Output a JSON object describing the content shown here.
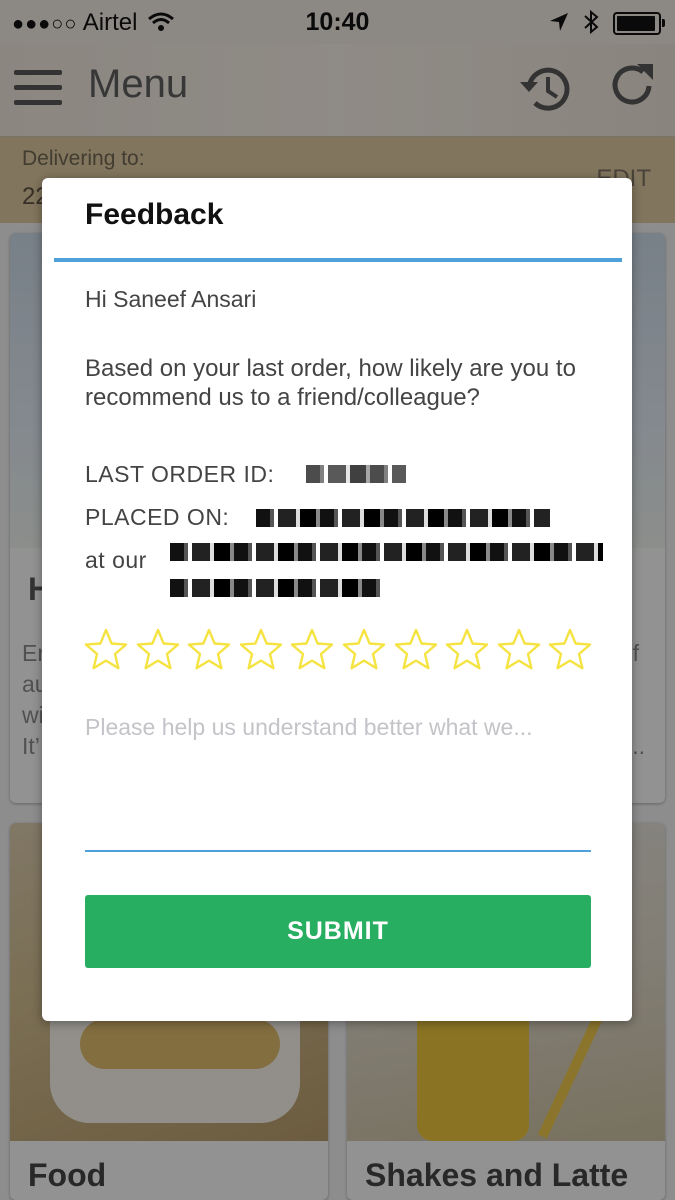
{
  "status_bar": {
    "carrier": "Airtel",
    "time": "10:40"
  },
  "header": {
    "title": "Menu",
    "icons": [
      "hamburger-icon",
      "history-icon",
      "refresh-icon"
    ]
  },
  "delivery": {
    "label": "Delivering to:",
    "address_partial": "22",
    "edit_label": "EDIT"
  },
  "background_cards": {
    "card1_heading_partial": "H",
    "card1_text_lines": [
      "En",
      "au",
      "wi",
      "It’"
    ],
    "card1_right_fragment": "f",
    "card1_ellipsis": "...",
    "food_label": "Food",
    "shakes_label": "Shakes and Latte"
  },
  "modal": {
    "title": "Feedback",
    "greeting": "Hi Saneef Ansari",
    "question": "Based on your last order, how likely are you to recommend us to a friend/colleague?",
    "last_order_label": "LAST ORDER ID:",
    "placed_on_label": "PLACED ON:",
    "at_our_label": "at our",
    "rating": {
      "max": 10,
      "value": 0
    },
    "feedback_placeholder": "Please help us understand better what we...",
    "submit_label": "SUBMIT"
  },
  "colors": {
    "accent_blue": "#4ea1d9",
    "submit_green": "#27ae60",
    "star_yellow": "#f5e342"
  }
}
